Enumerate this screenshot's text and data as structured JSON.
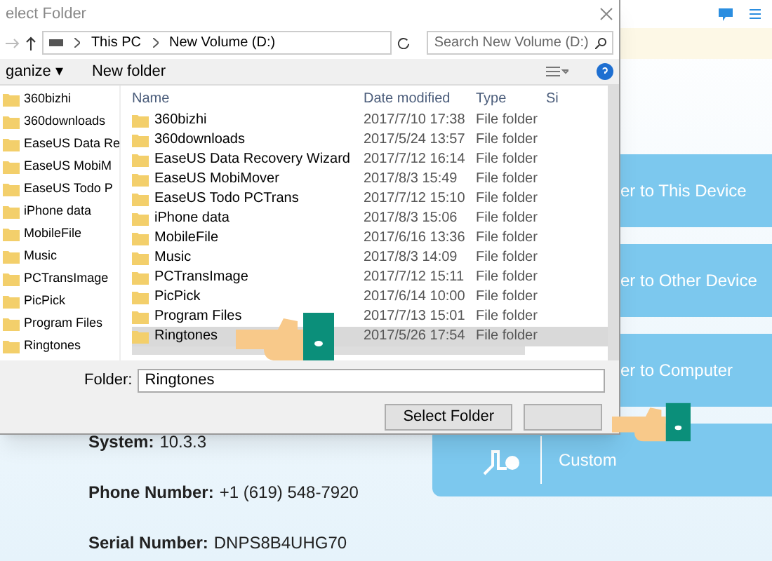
{
  "dialog": {
    "title": "elect Folder",
    "address": [
      "This PC",
      "New Volume (D:)"
    ],
    "search": {
      "placeholder": "Search New Volume (D:)"
    },
    "toolbar": [
      "ganize ▾",
      "New folder"
    ],
    "nav_items": [
      {
        "label": "360bizhi"
      },
      {
        "label": "360downloads"
      },
      {
        "label": "EaseUS Data Re"
      },
      {
        "label": "EaseUS MobiM"
      },
      {
        "label": "EaseUS Todo P"
      },
      {
        "label": "iPhone data"
      },
      {
        "label": "MobileFile"
      },
      {
        "label": "Music"
      },
      {
        "label": "PCTransImage"
      },
      {
        "label": "PicPick"
      },
      {
        "label": "Program Files"
      },
      {
        "label": "Ringtones"
      }
    ],
    "columns": [
      "Name",
      "Date modified",
      "Type",
      "Si"
    ],
    "rows": [
      {
        "name": "360bizhi",
        "date": "2017/7/10 17:38",
        "type": "File folder",
        "selected": false
      },
      {
        "name": "360downloads",
        "date": "2017/5/24 13:57",
        "type": "File folder",
        "selected": false
      },
      {
        "name": "EaseUS Data Recovery Wizard",
        "date": "2017/7/12 16:14",
        "type": "File folder",
        "selected": false
      },
      {
        "name": "EaseUS MobiMover",
        "date": "2017/8/3 15:49",
        "type": "File folder",
        "selected": false
      },
      {
        "name": "EaseUS Todo PCTrans",
        "date": "2017/7/12 15:10",
        "type": "File folder",
        "selected": false
      },
      {
        "name": "iPhone data",
        "date": "2017/8/3 15:06",
        "type": "File folder",
        "selected": false
      },
      {
        "name": "MobileFile",
        "date": "2017/6/16 13:36",
        "type": "File folder",
        "selected": false
      },
      {
        "name": "Music",
        "date": "2017/8/3 14:09",
        "type": "File folder",
        "selected": false
      },
      {
        "name": "PCTransImage",
        "date": "2017/7/12 15:11",
        "type": "File folder",
        "selected": false
      },
      {
        "name": "PicPick",
        "date": "2017/6/14 10:00",
        "type": "File folder",
        "selected": false
      },
      {
        "name": "Program Files",
        "date": "2017/7/13 15:01",
        "type": "File folder",
        "selected": false
      },
      {
        "name": "Ringtones",
        "date": "2017/5/26 17:54",
        "type": "File folder",
        "selected": true
      }
    ],
    "folder": {
      "label": "Folder:",
      "value": "Ringtones"
    },
    "buttons": [
      "Select Folder"
    ]
  },
  "tiles": [
    {
      "label": "er to This Device"
    },
    {
      "label": "er to Other Device"
    },
    {
      "label": "er to Computer"
    },
    {
      "label": "Custom"
    }
  ],
  "device_info": [
    {
      "label": "System:",
      "value": "10.3.3"
    },
    {
      "label": "Phone Number:",
      "value": "+1 (619) 548-7920"
    },
    {
      "label": "Serial Number:",
      "value": "DNPS8B4UHG70"
    }
  ]
}
